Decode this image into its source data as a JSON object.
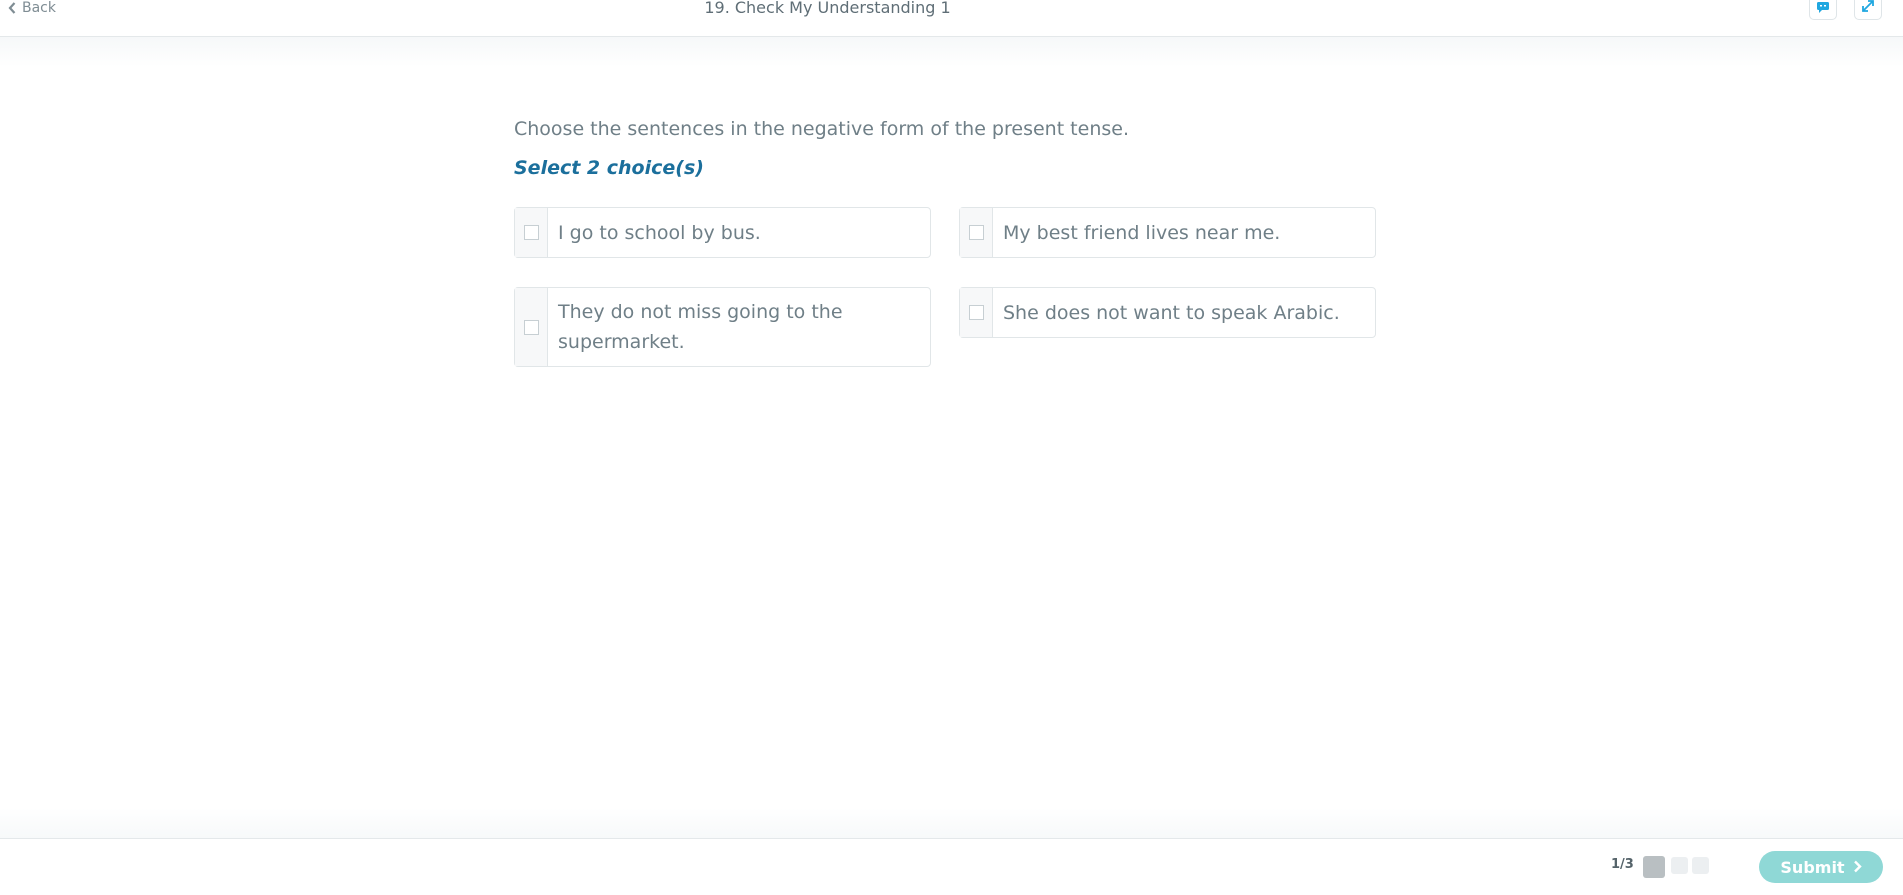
{
  "header": {
    "back_label": "Back",
    "title": "19. Check My Understanding 1"
  },
  "question": {
    "prompt": "Choose the sentences in the negative form of the present tense.",
    "instruction": "Select 2 choice(s)",
    "choices": [
      {
        "label": "I go to school by bus.",
        "checked": false
      },
      {
        "label": "My best friend lives near me.",
        "checked": false
      },
      {
        "label": "They do not miss going to the supermarket.",
        "checked": false
      },
      {
        "label": "She does not want to speak Arabic.",
        "checked": false
      }
    ]
  },
  "footer": {
    "progress": "1/3",
    "current_page": 1,
    "total_pages": 3,
    "submit_label": "Submit"
  },
  "colors": {
    "accent": "#1b6f9c",
    "submit_bg": "#8fd8d6",
    "icon_blue": "#1fa7e0"
  },
  "icons": {
    "back": "chevron-left-icon",
    "chat": "chat-icon",
    "expand": "expand-icon",
    "submit": "chevron-right-icon"
  }
}
